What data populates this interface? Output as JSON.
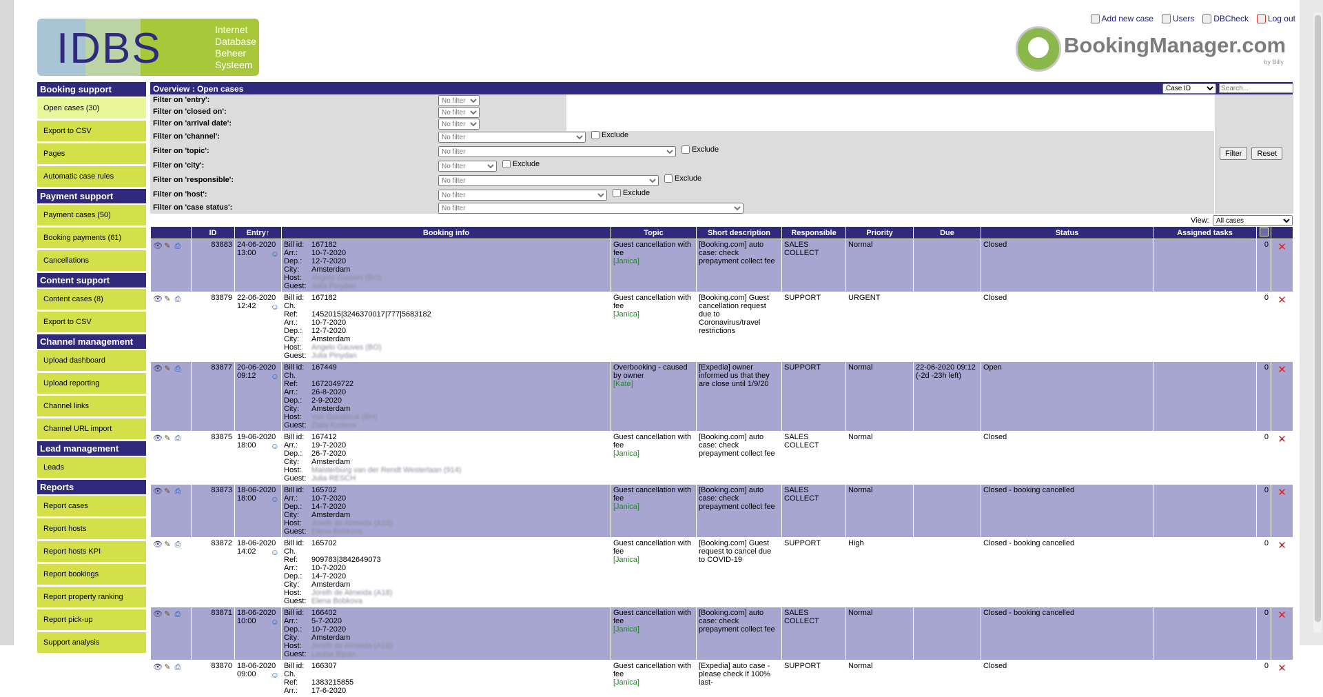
{
  "header": {
    "logo_mark": "IDBS",
    "logo_tagline": [
      "Internet",
      "Database",
      "Beheer",
      "Systeem"
    ],
    "toplinks": [
      {
        "label": "Add new case",
        "icon": "add-case-icon"
      },
      {
        "label": "Users",
        "icon": "users-icon"
      },
      {
        "label": "DBCheck",
        "icon": "dbcheck-icon"
      },
      {
        "label": "Log out",
        "icon": "logout-icon"
      }
    ],
    "brand": "BookingManager.com",
    "brand_by": "by Billy"
  },
  "sidebar": {
    "sections": [
      {
        "title": "Booking support",
        "items": [
          "Open cases (30)",
          "Export to CSV",
          "Pages",
          "Automatic case rules"
        ]
      },
      {
        "title": "Payment support",
        "items": [
          "Payment cases (50)",
          "Booking payments (61)",
          "Cancellations"
        ]
      },
      {
        "title": "Content support",
        "items": [
          "Content cases (8)",
          "Export to CSV"
        ]
      },
      {
        "title": "Channel management",
        "items": [
          "Upload dashboard",
          "Upload reporting",
          "Channel links",
          "Channel URL import"
        ]
      },
      {
        "title": "Lead management",
        "items": [
          "Leads"
        ]
      },
      {
        "title": "Reports",
        "items": [
          "Report cases",
          "Report hosts",
          "Report hosts KPI",
          "Report bookings",
          "Report property ranking",
          "Report pick-up",
          "Support analysis"
        ]
      }
    ],
    "active": "Open cases (30)"
  },
  "main": {
    "title": "Overview : Open cases",
    "search_type": "Case ID",
    "search_placeholder": "Search...",
    "filters": [
      {
        "label": "Filter on 'entry':",
        "value": "No filter",
        "exclude": false
      },
      {
        "label": "Filter on 'closed on':",
        "value": "No filter",
        "exclude": false
      },
      {
        "label": "Filter on 'arrival date':",
        "value": "No filter",
        "exclude": false
      },
      {
        "label": "Filter on 'channel':",
        "value": "No filter",
        "exclude": true
      },
      {
        "label": "Filter on 'topic':",
        "value": "No filter",
        "exclude": true
      },
      {
        "label": "Filter on 'city':",
        "value": "No filter",
        "exclude": true
      },
      {
        "label": "Filter on 'responsible':",
        "value": "No filter",
        "exclude": true
      },
      {
        "label": "Filter on 'host':",
        "value": "No filter",
        "exclude": true
      },
      {
        "label": "Filter on 'case status':",
        "value": "No filter",
        "exclude": false
      }
    ],
    "exclude_label": "Exclude",
    "filter_button": "Filter",
    "reset_button": "Reset",
    "view_label": "View:",
    "view_value": "All cases",
    "columns": [
      "",
      "ID",
      "Entry",
      "Booking info",
      "Topic",
      "Short description",
      "Responsible",
      "Priority",
      "Due",
      "Status",
      "Assigned tasks",
      "",
      ""
    ],
    "rows": [
      {
        "id": "83883",
        "entry_date": "24-06-2020",
        "entry_time": "13:00",
        "info": [
          [
            "Bill id:",
            "167182"
          ],
          [
            "Arr.:",
            "10-7-2020"
          ],
          [
            "Dep.:",
            "12-7-2020"
          ],
          [
            "City:",
            "Amsterdam"
          ],
          [
            "Host:",
            "Angelo Gauves (BO)"
          ],
          [
            "Guest:",
            "Julia Pinydan"
          ]
        ],
        "topic": "Guest cancellation with fee",
        "who": "[Janica]",
        "desc": "[Booking.com] auto case: check prepayment collect fee",
        "responsible": "SALES COLLECT",
        "priority": "Normal",
        "due": "",
        "status": "Closed",
        "tasks": "",
        "count": "0"
      },
      {
        "id": "83879",
        "entry_date": "22-06-2020",
        "entry_time": "12:42",
        "info": [
          [
            "Bill id:",
            "167182"
          ],
          [
            "Ch. Ref:",
            "1452015|3246370017|777|5683182"
          ],
          [
            "Arr.:",
            "10-7-2020"
          ],
          [
            "Dep.:",
            "12-7-2020"
          ],
          [
            "City:",
            "Amsterdam"
          ],
          [
            "Host:",
            "Angelo Gauves (BO)"
          ],
          [
            "Guest:",
            "Julia Pinydan"
          ]
        ],
        "topic": "Guest cancellation with fee",
        "who": "[Janica]",
        "desc": "[Booking.com] Guest cancellation request due to Coronavirus/travel restrictions",
        "responsible": "SUPPORT",
        "priority": "URGENT",
        "due": "",
        "status": "Closed",
        "tasks": "",
        "count": "0"
      },
      {
        "id": "83877",
        "entry_date": "20-06-2020",
        "entry_time": "09:12",
        "info": [
          [
            "Bill id:",
            "167449"
          ],
          [
            "Ch. Ref:",
            "1672049722"
          ],
          [
            "Arr.:",
            "26-8-2020"
          ],
          [
            "Dep.:",
            "2-9-2020"
          ],
          [
            "City:",
            "Amsterdam"
          ],
          [
            "Host:",
            "Van Gouddruk (BH)"
          ],
          [
            "Guest:",
            "Zlata Kudeva"
          ]
        ],
        "topic": "Overbooking - caused by owner",
        "who": "[Kate]",
        "desc": "[Expedia] owner informed us that they are close until 1/9/20",
        "responsible": "SUPPORT",
        "priority": "Normal",
        "due": "22-06-2020 09:12 (-2d -23h left)",
        "status": "Open",
        "tasks": "",
        "count": "0"
      },
      {
        "id": "83875",
        "entry_date": "19-06-2020",
        "entry_time": "18:00",
        "info": [
          [
            "Bill id:",
            "167412"
          ],
          [
            "Arr.:",
            "19-7-2020"
          ],
          [
            "Dep.:",
            "26-7-2020"
          ],
          [
            "City:",
            "Amsterdam"
          ],
          [
            "Host:",
            "Maisterburg van der Rendt Westerlaan (914)"
          ],
          [
            "Guest:",
            "Julia RESCH"
          ]
        ],
        "topic": "Guest cancellation with fee",
        "who": "[Janica]",
        "desc": "[Booking.com] auto case: check prepayment collect fee",
        "responsible": "SALES COLLECT",
        "priority": "Normal",
        "due": "",
        "status": "Closed",
        "tasks": "",
        "count": "0"
      },
      {
        "id": "83873",
        "entry_date": "18-06-2020",
        "entry_time": "18:00",
        "info": [
          [
            "Bill id:",
            "165702"
          ],
          [
            "Arr.:",
            "10-7-2020"
          ],
          [
            "Dep.:",
            "14-7-2020"
          ],
          [
            "City:",
            "Amsterdam"
          ],
          [
            "Host:",
            "Jorelh de Almeida (A18)"
          ],
          [
            "Guest:",
            "Elena Bobkova"
          ]
        ],
        "topic": "Guest cancellation with fee",
        "who": "[Janica]",
        "desc": "[Booking.com] auto case: check prepayment collect fee",
        "responsible": "SALES COLLECT",
        "priority": "Normal",
        "due": "",
        "status": "Closed - booking cancelled",
        "tasks": "",
        "count": "0"
      },
      {
        "id": "83872",
        "entry_date": "18-06-2020",
        "entry_time": "14:02",
        "info": [
          [
            "Bill id:",
            "165702"
          ],
          [
            "Ch. Ref:",
            "909783|3842649073"
          ],
          [
            "Arr.:",
            "10-7-2020"
          ],
          [
            "Dep.:",
            "14-7-2020"
          ],
          [
            "City:",
            "Amsterdam"
          ],
          [
            "Host:",
            "Jorelh de Almeida (A18)"
          ],
          [
            "Guest:",
            "Elena Bobkova"
          ]
        ],
        "topic": "Guest cancellation with fee",
        "who": "[Janica]",
        "desc": "[Booking.com] Guest request to cancel due to COVID-19",
        "responsible": "SUPPORT",
        "priority": "High",
        "due": "",
        "status": "Closed - booking cancelled",
        "tasks": "",
        "count": "0"
      },
      {
        "id": "83871",
        "entry_date": "18-06-2020",
        "entry_time": "10:00",
        "info": [
          [
            "Bill id:",
            "166402"
          ],
          [
            "Arr.:",
            "5-7-2020"
          ],
          [
            "Dep.:",
            "10-7-2020"
          ],
          [
            "City:",
            "Amsterdam"
          ],
          [
            "Host:",
            "Jorelh de Almeida (A18)"
          ],
          [
            "Guest:",
            "Louise Bipan"
          ]
        ],
        "topic": "Guest cancellation with fee",
        "who": "[Janica]",
        "desc": "[Booking.com] auto case: check prepayment collect fee",
        "responsible": "SALES COLLECT",
        "priority": "Normal",
        "due": "",
        "status": "Closed - booking cancelled",
        "tasks": "",
        "count": "0"
      },
      {
        "id": "83870",
        "entry_date": "18-06-2020",
        "entry_time": "09:00",
        "info": [
          [
            "Bill id:",
            "166307"
          ],
          [
            "Ch. Ref:",
            "1383215855"
          ],
          [
            "Arr.:",
            "17-6-2020"
          ]
        ],
        "topic": "Guest cancellation with fee",
        "who": "[Janica]",
        "desc": "[Expedia] auto case - please check if 100% last-",
        "responsible": "SUPPORT",
        "priority": "Normal",
        "due": "",
        "status": "Closed",
        "tasks": "",
        "count": "0"
      }
    ]
  }
}
